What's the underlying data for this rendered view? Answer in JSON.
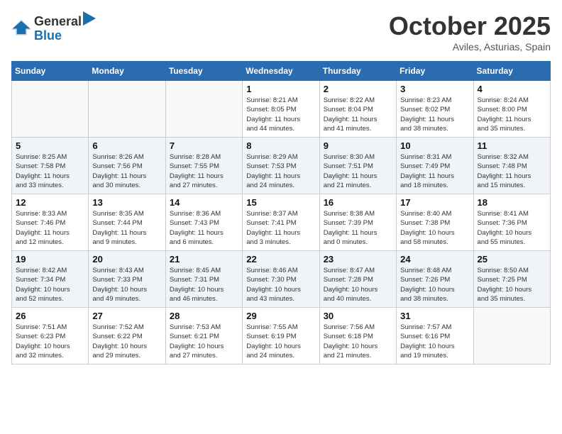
{
  "header": {
    "logo_general": "General",
    "logo_blue": "Blue",
    "month": "October 2025",
    "location": "Aviles, Asturias, Spain"
  },
  "weekdays": [
    "Sunday",
    "Monday",
    "Tuesday",
    "Wednesday",
    "Thursday",
    "Friday",
    "Saturday"
  ],
  "weeks": [
    [
      {
        "day": "",
        "info": ""
      },
      {
        "day": "",
        "info": ""
      },
      {
        "day": "",
        "info": ""
      },
      {
        "day": "1",
        "info": "Sunrise: 8:21 AM\nSunset: 8:05 PM\nDaylight: 11 hours\nand 44 minutes."
      },
      {
        "day": "2",
        "info": "Sunrise: 8:22 AM\nSunset: 8:04 PM\nDaylight: 11 hours\nand 41 minutes."
      },
      {
        "day": "3",
        "info": "Sunrise: 8:23 AM\nSunset: 8:02 PM\nDaylight: 11 hours\nand 38 minutes."
      },
      {
        "day": "4",
        "info": "Sunrise: 8:24 AM\nSunset: 8:00 PM\nDaylight: 11 hours\nand 35 minutes."
      }
    ],
    [
      {
        "day": "5",
        "info": "Sunrise: 8:25 AM\nSunset: 7:58 PM\nDaylight: 11 hours\nand 33 minutes."
      },
      {
        "day": "6",
        "info": "Sunrise: 8:26 AM\nSunset: 7:56 PM\nDaylight: 11 hours\nand 30 minutes."
      },
      {
        "day": "7",
        "info": "Sunrise: 8:28 AM\nSunset: 7:55 PM\nDaylight: 11 hours\nand 27 minutes."
      },
      {
        "day": "8",
        "info": "Sunrise: 8:29 AM\nSunset: 7:53 PM\nDaylight: 11 hours\nand 24 minutes."
      },
      {
        "day": "9",
        "info": "Sunrise: 8:30 AM\nSunset: 7:51 PM\nDaylight: 11 hours\nand 21 minutes."
      },
      {
        "day": "10",
        "info": "Sunrise: 8:31 AM\nSunset: 7:49 PM\nDaylight: 11 hours\nand 18 minutes."
      },
      {
        "day": "11",
        "info": "Sunrise: 8:32 AM\nSunset: 7:48 PM\nDaylight: 11 hours\nand 15 minutes."
      }
    ],
    [
      {
        "day": "12",
        "info": "Sunrise: 8:33 AM\nSunset: 7:46 PM\nDaylight: 11 hours\nand 12 minutes."
      },
      {
        "day": "13",
        "info": "Sunrise: 8:35 AM\nSunset: 7:44 PM\nDaylight: 11 hours\nand 9 minutes."
      },
      {
        "day": "14",
        "info": "Sunrise: 8:36 AM\nSunset: 7:43 PM\nDaylight: 11 hours\nand 6 minutes."
      },
      {
        "day": "15",
        "info": "Sunrise: 8:37 AM\nSunset: 7:41 PM\nDaylight: 11 hours\nand 3 minutes."
      },
      {
        "day": "16",
        "info": "Sunrise: 8:38 AM\nSunset: 7:39 PM\nDaylight: 11 hours\nand 0 minutes."
      },
      {
        "day": "17",
        "info": "Sunrise: 8:40 AM\nSunset: 7:38 PM\nDaylight: 10 hours\nand 58 minutes."
      },
      {
        "day": "18",
        "info": "Sunrise: 8:41 AM\nSunset: 7:36 PM\nDaylight: 10 hours\nand 55 minutes."
      }
    ],
    [
      {
        "day": "19",
        "info": "Sunrise: 8:42 AM\nSunset: 7:34 PM\nDaylight: 10 hours\nand 52 minutes."
      },
      {
        "day": "20",
        "info": "Sunrise: 8:43 AM\nSunset: 7:33 PM\nDaylight: 10 hours\nand 49 minutes."
      },
      {
        "day": "21",
        "info": "Sunrise: 8:45 AM\nSunset: 7:31 PM\nDaylight: 10 hours\nand 46 minutes."
      },
      {
        "day": "22",
        "info": "Sunrise: 8:46 AM\nSunset: 7:30 PM\nDaylight: 10 hours\nand 43 minutes."
      },
      {
        "day": "23",
        "info": "Sunrise: 8:47 AM\nSunset: 7:28 PM\nDaylight: 10 hours\nand 40 minutes."
      },
      {
        "day": "24",
        "info": "Sunrise: 8:48 AM\nSunset: 7:26 PM\nDaylight: 10 hours\nand 38 minutes."
      },
      {
        "day": "25",
        "info": "Sunrise: 8:50 AM\nSunset: 7:25 PM\nDaylight: 10 hours\nand 35 minutes."
      }
    ],
    [
      {
        "day": "26",
        "info": "Sunrise: 7:51 AM\nSunset: 6:23 PM\nDaylight: 10 hours\nand 32 minutes."
      },
      {
        "day": "27",
        "info": "Sunrise: 7:52 AM\nSunset: 6:22 PM\nDaylight: 10 hours\nand 29 minutes."
      },
      {
        "day": "28",
        "info": "Sunrise: 7:53 AM\nSunset: 6:21 PM\nDaylight: 10 hours\nand 27 minutes."
      },
      {
        "day": "29",
        "info": "Sunrise: 7:55 AM\nSunset: 6:19 PM\nDaylight: 10 hours\nand 24 minutes."
      },
      {
        "day": "30",
        "info": "Sunrise: 7:56 AM\nSunset: 6:18 PM\nDaylight: 10 hours\nand 21 minutes."
      },
      {
        "day": "31",
        "info": "Sunrise: 7:57 AM\nSunset: 6:16 PM\nDaylight: 10 hours\nand 19 minutes."
      },
      {
        "day": "",
        "info": ""
      }
    ]
  ]
}
